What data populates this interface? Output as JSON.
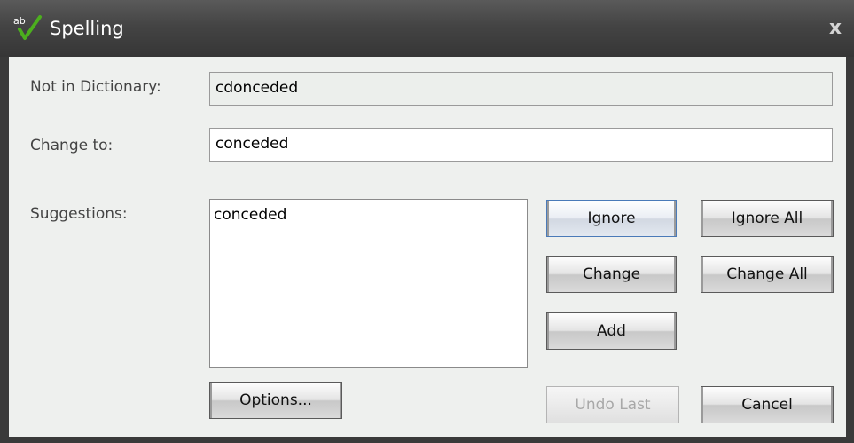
{
  "dialog": {
    "title": "Spelling",
    "icon": "spell-check-icon",
    "close_glyph": "x"
  },
  "form": {
    "not_in_dictionary_label": "Not in Dictionary:",
    "not_in_dictionary_value": "cdonceded",
    "change_to_label": "Change to:",
    "change_to_value": "conceded",
    "suggestions_label": "Suggestions:",
    "suggestions": [
      "conceded"
    ]
  },
  "buttons": {
    "ignore": "Ignore",
    "ignore_all": "Ignore All",
    "change": "Change",
    "change_all": "Change All",
    "add": "Add",
    "options": "Options...",
    "undo_last": "Undo Last",
    "cancel": "Cancel"
  },
  "colors": {
    "titlebar": "#444444",
    "dialog_background": "#eef0ee",
    "checkmark_green": "#4caf1e",
    "default_button_border": "#4a7ab8",
    "disabled_text": "#a8a8a8"
  }
}
